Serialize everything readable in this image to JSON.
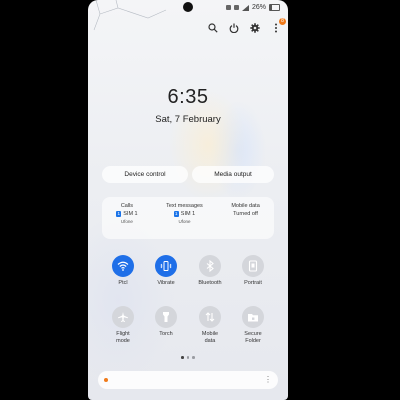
{
  "status_bar": {
    "battery_text": "26%"
  },
  "header": {
    "badge": "8"
  },
  "clock": {
    "time": "6:35",
    "date": "Sat, 7 February"
  },
  "buttons": {
    "device_control": "Device control",
    "media_output": "Media output"
  },
  "sim_info": [
    {
      "title": "Calls",
      "sim": "SIM 1",
      "operator": "Ufone"
    },
    {
      "title": "Text messages",
      "sim": "SIM 1",
      "operator": "Ufone"
    },
    {
      "title": "Mobile data",
      "status": "Turned off"
    }
  ],
  "sim_badge_number": "1",
  "toggles": [
    {
      "label": "Ptcl",
      "icon": "wifi-icon",
      "active": true
    },
    {
      "label": "Vibrate",
      "icon": "vibrate-icon",
      "active": true
    },
    {
      "label": "Bluetooth",
      "icon": "bluetooth-icon",
      "active": false
    },
    {
      "label": "Portrait",
      "icon": "portrait-icon",
      "active": false
    },
    {
      "label": "Flight\nmode",
      "icon": "airplane-icon",
      "active": false
    },
    {
      "label": "Torch",
      "icon": "torch-icon",
      "active": false
    },
    {
      "label": "Mobile\ndata",
      "icon": "mobile-data-icon",
      "active": false
    },
    {
      "label": "Secure\nFolder",
      "icon": "secure-folder-icon",
      "active": false
    }
  ],
  "pager": {
    "pages": 3,
    "active": 0
  },
  "colors": {
    "accent": "#1f6fe8",
    "badge": "#f07a1a",
    "inactive": "#d4d6db"
  }
}
